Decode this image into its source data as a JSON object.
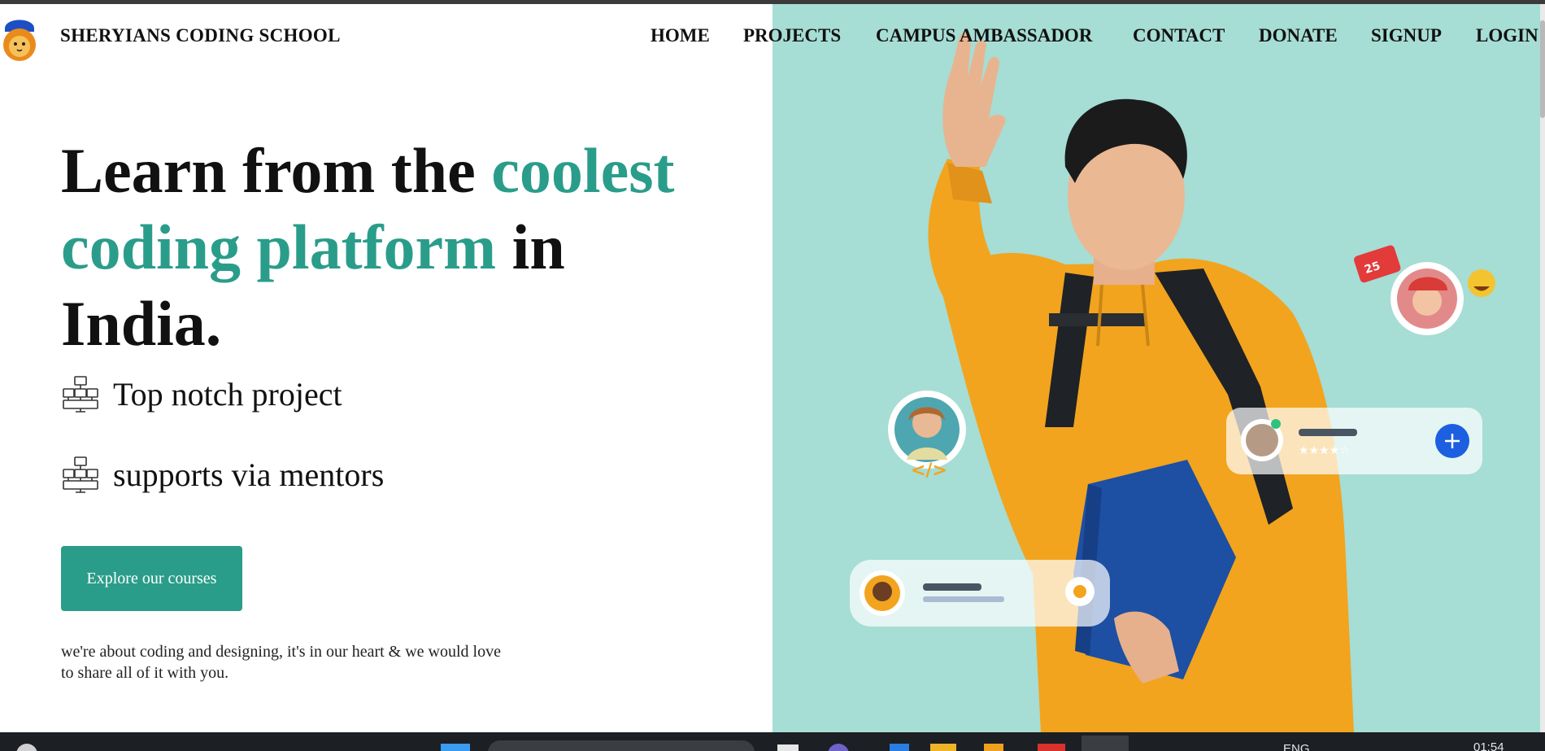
{
  "brand": {
    "name": "SHERYIANS CODING SCHOOL",
    "logo": "lion-logo-icon"
  },
  "nav": {
    "items": [
      {
        "label": "HOME"
      },
      {
        "label": "PROJECTS"
      },
      {
        "label": "CAMPUS AMBASSADOR"
      },
      {
        "label": "CONTACT"
      },
      {
        "label": "DONATE"
      },
      {
        "label": "SIGNUP"
      },
      {
        "label": "LOGIN"
      }
    ]
  },
  "hero": {
    "headline_part1": "Learn from the ",
    "headline_accent1": "coolest",
    "headline_accent2": "coding platform",
    "headline_part2": " in",
    "headline_part3": "India.",
    "features": [
      {
        "icon": "computer-network-icon",
        "text": "Top notch project"
      },
      {
        "icon": "computer-network-icon",
        "text": "supports via mentors"
      }
    ],
    "cta_label": "Explore our courses",
    "tagline_line1": "we're about coding and designing, it's in our heart & we would love",
    "tagline_line2": "to share all of it with you.",
    "badge_count": "25"
  },
  "taskbar": {
    "lang": "ENG",
    "time": "01:54"
  },
  "colors": {
    "accent": "#2a9d8a",
    "hero_bg": "#a6ddd5",
    "hoodie": "#f2a41e",
    "plus_button": "#1c5fe0"
  }
}
